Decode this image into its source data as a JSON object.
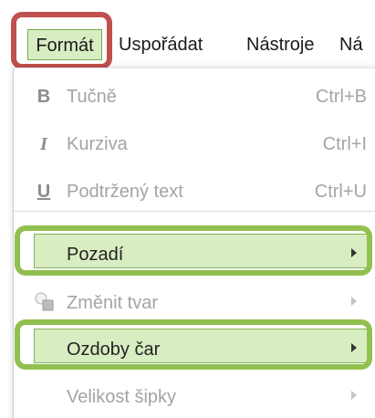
{
  "menubar": {
    "items": [
      {
        "label": "Formát"
      },
      {
        "label": "Uspořádat"
      },
      {
        "label": "Nástroje"
      },
      {
        "label": "Ná"
      }
    ]
  },
  "dropdown": {
    "items": [
      {
        "icon": "bold-icon",
        "icon_text": "B",
        "label": "Tučně",
        "shortcut": "Ctrl+B",
        "enabled": false
      },
      {
        "icon": "italic-icon",
        "icon_text": "I",
        "label": "Kurziva",
        "shortcut": "Ctrl+I",
        "enabled": false
      },
      {
        "icon": "underline-icon",
        "icon_text": "U",
        "label": "Podtržený text",
        "shortcut": "Ctrl+U",
        "enabled": false
      },
      {
        "icon": "",
        "label": "Pozadí",
        "has_submenu": true,
        "enabled": true,
        "highlighted": true
      },
      {
        "icon": "change-shape-icon",
        "label": "Změnit tvar",
        "has_submenu": true,
        "enabled": false
      },
      {
        "icon": "",
        "label": "Ozdoby čar",
        "has_submenu": true,
        "enabled": true,
        "highlighted": true
      },
      {
        "icon": "",
        "label": "Velikost šipky",
        "has_submenu": true,
        "enabled": false
      }
    ]
  },
  "colors": {
    "highlight_fill": "#d9edc3",
    "highlight_border": "#84b158",
    "callout_green": "#92c050",
    "callout_red": "#c0504d",
    "disabled_text": "#a4a4a4"
  }
}
